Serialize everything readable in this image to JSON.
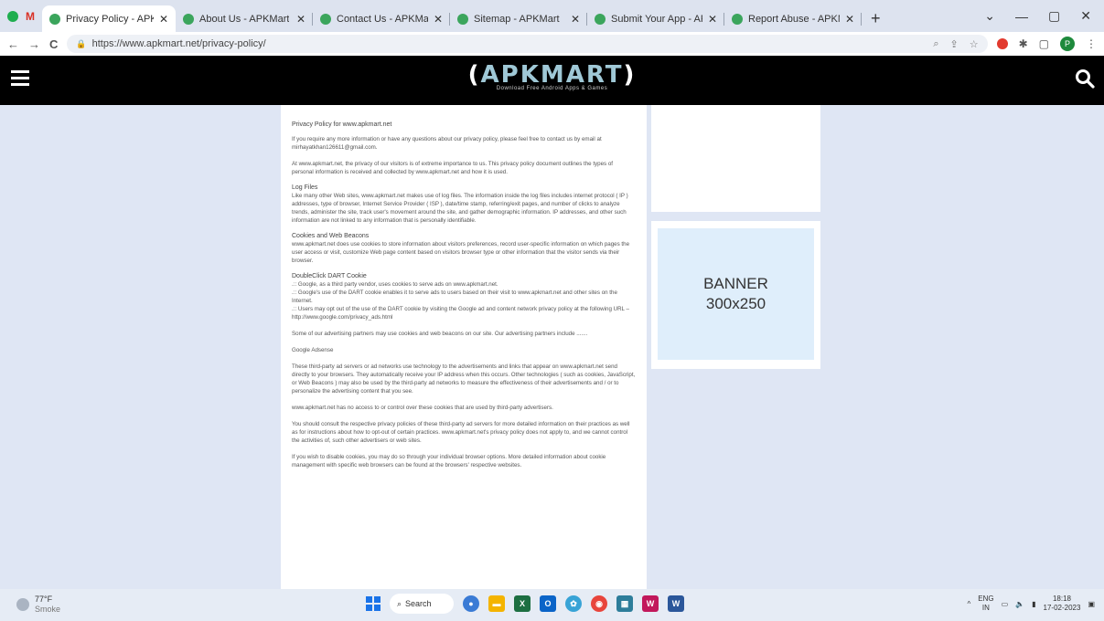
{
  "browser": {
    "tabs": [
      {
        "title": "Privacy Policy - APKMart",
        "active": true
      },
      {
        "title": "About Us - APKMart",
        "active": false
      },
      {
        "title": "Contact Us - APKMart",
        "active": false
      },
      {
        "title": "Sitemap - APKMart",
        "active": false
      },
      {
        "title": "Submit Your App - APK",
        "active": false
      },
      {
        "title": "Report Abuse - APKMart",
        "active": false
      }
    ],
    "url": "https://www.apkmart.net/privacy-policy/",
    "profile_initial": "P"
  },
  "site": {
    "logo_text": "APKMART",
    "logo_open": "(",
    "logo_close": ")",
    "logo_tagline": "Download Free Android Apps & Games"
  },
  "article": {
    "heading": "Privacy Policy for www.apkmart.net",
    "para1": "If you require any more information or have any questions about our privacy policy, please feel free to contact us by email at mirhayatkhan126611@gmail.com.",
    "para2": "At www.apkmart.net, the privacy of our visitors is of extreme importance to us. This privacy policy document outlines the types of personal information is received and collected by www.apkmart.net and how it is used.",
    "log_title": "Log Files",
    "log_body": "Like many other Web sites, www.apkmart.net makes use of log files. The information inside the log files includes internet protocol ( IP ) addresses, type of browser, Internet Service Provider ( ISP ), date/time stamp, referring/exit pages, and number of clicks to analyze trends, administer the site, track user's movement around the site, and gather demographic information. IP addresses, and other such information are not linked to any information that is personally identifiable.",
    "cookies_title": "Cookies and Web Beacons",
    "cookies_body": "www.apkmart.net does use cookies to store information about visitors preferences, record user-specific information on which pages the user access or visit, customize Web page content based on visitors browser type or other information that the visitor sends via their browser.",
    "dart_title": "DoubleClick DART Cookie",
    "dart_1": ".:: Google, as a third party vendor, uses cookies to serve ads on www.apkmart.net.",
    "dart_2": ".:: Google's use of the DART cookie enables it to serve ads to users based on their visit to www.apkmart.net and other sites on the Internet.",
    "dart_3": ".:: Users may opt out of the use of the DART cookie by visiting the Google ad and content network privacy policy at the following URL – http://www.google.com/privacy_ads.html",
    "partners": "Some of our advertising partners may use cookies and web beacons on our site. Our advertising partners include .......",
    "google_adsense": "Google Adsense",
    "thirdparty": "These third-party ad servers or ad networks use technology to the advertisements and links that appear on www.apkmart.net send directly to your browsers. They automatically receive your IP address when this occurs. Other technologies ( such as cookies, JavaScript, or Web Beacons ) may also be used by the third-party ad networks to measure the effectiveness of their advertisements and / or to personalize the advertising content that you see.",
    "noaccess": "www.apkmart.net has no access to or control over these cookies that are used by third-party advertisers.",
    "consult": "You should consult the respective privacy policies of these third-party ad servers for more detailed information on their practices as well as for instructions about how to opt-out of certain practices. www.apkmart.net's privacy policy does not apply to, and we cannot control the activities of, such other advertisers or web sites.",
    "disable": "If you wish to disable cookies, you may do so through your individual browser options. More detailed information about cookie management with specific web browsers can be found at the browsers' respective websites."
  },
  "sidebar": {
    "banner_line1": "BANNER",
    "banner_line2": "300x250"
  },
  "taskbar": {
    "temp": "77°F",
    "weather": "Smoke",
    "search_label": "Search",
    "lang1": "ENG",
    "lang2": "IN",
    "time": "18:18",
    "date": "17-02-2023"
  }
}
